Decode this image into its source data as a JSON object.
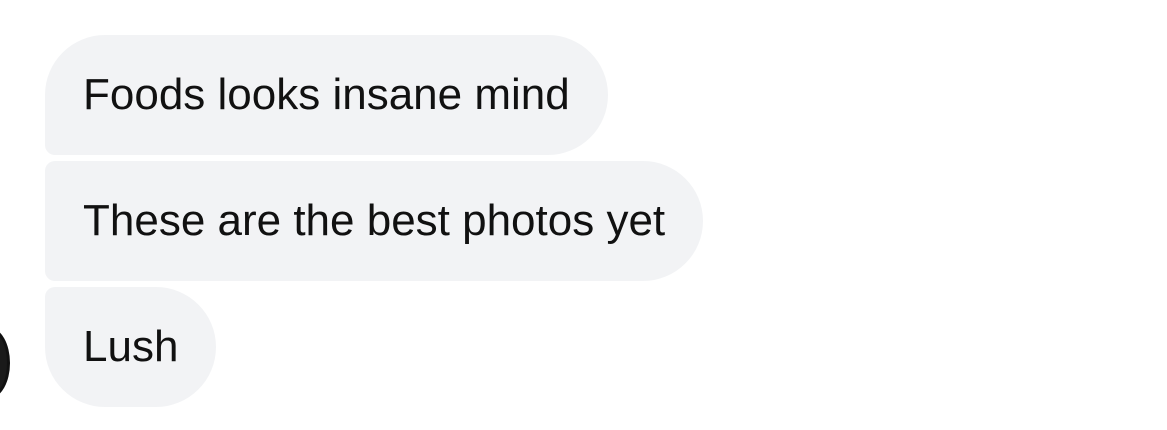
{
  "conversation": {
    "messages": [
      {
        "text": "Foods looks insane mind"
      },
      {
        "text": "These are the best photos yet"
      },
      {
        "text": "Lush"
      }
    ]
  },
  "colors": {
    "bubble_background": "#f2f3f5",
    "text": "#111111",
    "page_background": "#ffffff"
  },
  "icons": {
    "avatar": "avatar-icon"
  }
}
